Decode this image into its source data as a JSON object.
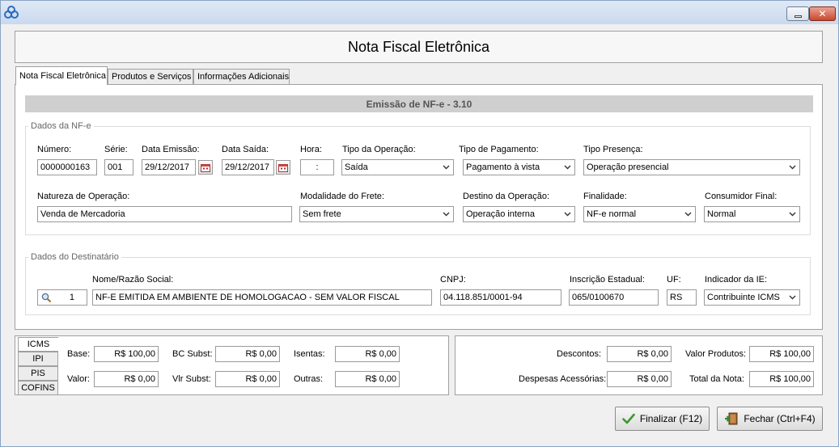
{
  "window": {
    "title": "Nota Fiscal Eletrônica"
  },
  "tabs": [
    {
      "label": "Nota Fiscal Eletrônica",
      "active": true
    },
    {
      "label": "Produtos e Serviços",
      "active": false
    },
    {
      "label": "Informações Adicionais",
      "active": false
    }
  ],
  "emissao_title": "Emissão de NF-e - 3.10",
  "dados_nfe": {
    "group_title": "Dados da NF-e",
    "numero": {
      "label": "Número:",
      "value": "0000000163"
    },
    "serie": {
      "label": "Série:",
      "value": "001"
    },
    "data_emissao": {
      "label": "Data Emissão:",
      "value": "29/12/2017"
    },
    "data_saida": {
      "label": "Data Saída:",
      "value": "29/12/2017"
    },
    "hora": {
      "label": "Hora:",
      "value": ":"
    },
    "tipo_operacao": {
      "label": "Tipo da Operação:",
      "value": "Saída"
    },
    "tipo_pagamento": {
      "label": "Tipo de Pagamento:",
      "value": "Pagamento à vista"
    },
    "tipo_presenca": {
      "label": "Tipo Presença:",
      "value": "Operação presencial"
    },
    "natureza": {
      "label": "Natureza de Operação:",
      "value": "Venda de Mercadoria"
    },
    "modalidade_frete": {
      "label": "Modalidade do Frete:",
      "value": "Sem frete"
    },
    "destino": {
      "label": "Destino da Operação:",
      "value": "Operação interna"
    },
    "finalidade": {
      "label": "Finalidade:",
      "value": "NF-e normal"
    },
    "consumidor_final": {
      "label": "Consumidor Final:",
      "value": "Normal"
    }
  },
  "destinatario": {
    "group_title": "Dados do Destinatário",
    "codigo": "1",
    "nome": {
      "label": "Nome/Razão Social:",
      "value": "NF-E EMITIDA EM AMBIENTE DE HOMOLOGACAO - SEM VALOR FISCAL"
    },
    "cnpj": {
      "label": "CNPJ:",
      "value": "04.118.851/0001-94"
    },
    "ie": {
      "label": "Inscrição Estadual:",
      "value": "065/0100670"
    },
    "uf": {
      "label": "UF:",
      "value": "RS"
    },
    "indicador_ie": {
      "label": "Indicador da IE:",
      "value": "Contribuinte ICMS"
    }
  },
  "tax_tabs": [
    "ICMS",
    "IPI",
    "PIS",
    "COFINS"
  ],
  "icms": {
    "base": {
      "label": "Base:",
      "value": "R$ 100,00"
    },
    "valor": {
      "label": "Valor:",
      "value": "R$ 0,00"
    },
    "bc_subst": {
      "label": "BC Subst:",
      "value": "R$ 0,00"
    },
    "vlr_subst": {
      "label": "Vlr Subst:",
      "value": "R$ 0,00"
    },
    "isentas": {
      "label": "Isentas:",
      "value": "R$ 0,00"
    },
    "outras": {
      "label": "Outras:",
      "value": "R$ 0,00"
    }
  },
  "totais": {
    "descontos": {
      "label": "Descontos:",
      "value": "R$ 0,00"
    },
    "despesas": {
      "label": "Despesas Acessórias:",
      "value": "R$ 0,00"
    },
    "valor_produtos": {
      "label": "Valor Produtos:",
      "value": "R$ 100,00"
    },
    "total_nota": {
      "label": "Total da Nota:",
      "value": "R$ 100,00"
    }
  },
  "buttons": {
    "finalizar": "Finalizar (F12)",
    "fechar": "Fechar (Ctrl+F4)"
  },
  "colors": {
    "accent_check": "#3a9a2e",
    "titlebar": "#c9d9ee",
    "close_button": "#c9462c"
  }
}
